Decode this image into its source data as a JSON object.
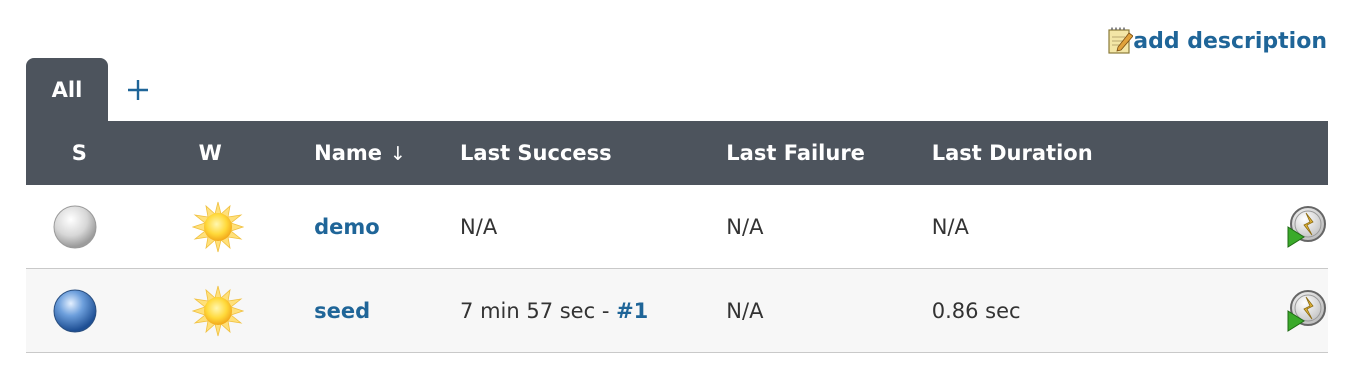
{
  "header": {
    "add_description_label": "add description",
    "note_icon": "edit-note-icon"
  },
  "tabs": [
    {
      "label": "All",
      "active": true
    },
    {
      "label": "+",
      "active": false
    }
  ],
  "table": {
    "columns": {
      "status": "S",
      "weather": "W",
      "name": "Name",
      "sort_indicator": "↓",
      "last_success": "Last Success",
      "last_failure": "Last Failure",
      "last_duration": "Last Duration"
    },
    "rows": [
      {
        "status_icon": "grey-ball-icon",
        "weather_icon": "sunny-icon",
        "name": "demo",
        "last_success_text": "N/A",
        "last_success_build": "",
        "last_failure": "N/A",
        "last_duration": "N/A",
        "action_icon": "schedule-build-icon"
      },
      {
        "status_icon": "blue-ball-icon",
        "weather_icon": "sunny-icon",
        "name": "seed",
        "last_success_text": "7 min 57 sec - ",
        "last_success_build": "#1",
        "last_failure": "N/A",
        "last_duration": "0.86 sec",
        "action_icon": "schedule-build-icon"
      }
    ]
  },
  "colors": {
    "header_bg": "#4d545d",
    "link": "#1f6598",
    "row_alt_bg": "#f7f7f7"
  }
}
